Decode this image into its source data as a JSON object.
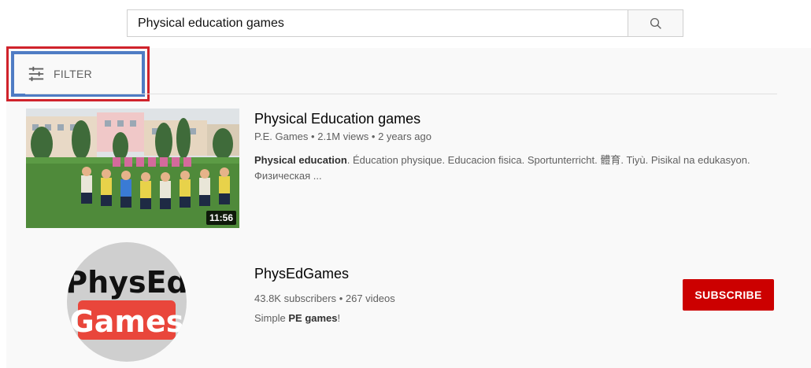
{
  "search": {
    "query": "Physical education games",
    "icon": "search-icon"
  },
  "filter": {
    "label": "FILTER",
    "icon": "sliders-icon"
  },
  "highlight_colors": {
    "outer": "#d0232b",
    "inner": "#4f7cc4"
  },
  "video": {
    "title": "Physical Education games",
    "channel": "P.E. Games",
    "views": "2.1M views",
    "age": "2 years ago",
    "description_bold": "Physical education",
    "description_rest": ". Éducation physique. Educacion fisica. Sportunterricht. 體育. Tiyù. Pisikal na edukasyon. Физическая ...",
    "duration": "11:56"
  },
  "channel": {
    "name": "PhysEdGames",
    "subscribers": "43.8K subscribers",
    "videos": "267 videos",
    "desc_prefix": "Simple ",
    "desc_bold": "PE games",
    "desc_suffix": "!",
    "avatar_text_top": "PhysEd",
    "avatar_text_bottom": "Games",
    "subscribe_label": "SUBSCRIBE",
    "brand_color": "#e9463b"
  },
  "sep": "•"
}
